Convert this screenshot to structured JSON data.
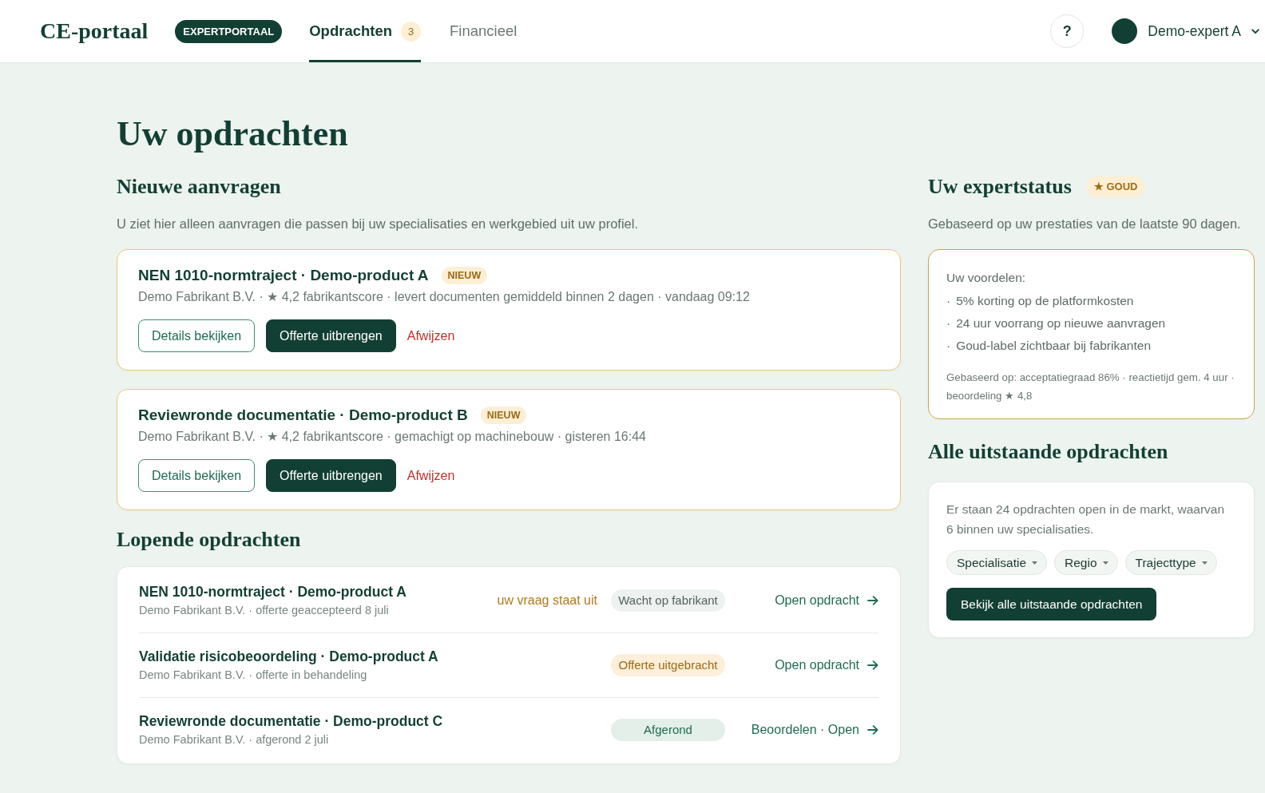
{
  "header": {
    "logo": "CE-portaal",
    "portal_badge": "EXPERTPORTAAL",
    "tabs": [
      {
        "label": "Opdrachten",
        "count": "3",
        "selected": true
      },
      {
        "label": "Financieel",
        "selected": false
      }
    ],
    "help_button": "?",
    "user": {
      "name": "Demo-expert A"
    }
  },
  "page_title": "Uw opdrachten",
  "new_requests": {
    "title": "Nieuwe aanvragen",
    "description": "U ziet hier alleen aanvragen die passen bij uw specialisaties en werkgebied uit uw profiel.",
    "cards": [
      {
        "title": "NEN 1010-normtraject · Demo-product A",
        "badge": "NIEUW",
        "meta": "Demo Fabrikant B.V. · ★ 4,2 fabrikantscore · levert documenten gemiddeld binnen 2 dagen · vandaag 09:12",
        "actions": [
          {
            "label": "Details bekijken",
            "kind": "secondary"
          },
          {
            "label": "Offerte uitbrengen",
            "kind": "primary"
          },
          {
            "label": "Afwijzen",
            "kind": "danger"
          }
        ]
      },
      {
        "title": "Reviewronde documentatie · Demo-product B",
        "badge": "NIEUW",
        "meta": "Demo Fabrikant B.V. · ★ 4,2 fabrikantscore · gemachigt op machinebouw · gisteren 16:44",
        "actions": [
          {
            "label": "Details bekijken",
            "kind": "secondary"
          },
          {
            "label": "Offerte uitbrengen",
            "kind": "primary"
          },
          {
            "label": "Afwijzen",
            "kind": "danger"
          }
        ]
      }
    ]
  },
  "running": {
    "title": "Lopende opdrachten",
    "rows": [
      {
        "title": "NEN 1010-normtraject · Demo-product A",
        "subtitle": "Demo Fabrikant B.V. · offerte geaccepteerd 8 juli",
        "note": "uw vraag staat uit",
        "status": {
          "label": "Wacht op fabrikant",
          "kind": "neutral"
        },
        "link": "Open opdracht"
      },
      {
        "title": "Validatie risicobeoordeling · Demo-product A",
        "subtitle": "Demo Fabrikant B.V. · offerte in behandeling",
        "status": {
          "label": "Offerte uitgebracht",
          "kind": "warning"
        },
        "link": "Open opdracht"
      },
      {
        "title": "Reviewronde documentatie · Demo-product C",
        "subtitle": "Demo Fabrikant B.V. · afgerond 2 juli",
        "status": {
          "label": "Afgerond",
          "kind": "success"
        },
        "link": "Beoordelen · Open"
      }
    ]
  },
  "expert_status": {
    "title": "Uw expertstatus",
    "badge": "★ GOUD",
    "subtitle": "Gebaseerd op uw prestaties van de laatste 90 dagen.",
    "benefits_title": "Uw voordelen:",
    "benefits": [
      {
        "marker": "·",
        "text": "5% korting op de platformkosten"
      },
      {
        "marker": "·",
        "text": "24 uur voorrang op nieuwe aanvragen"
      },
      {
        "marker": "·",
        "text": "Goud-label zichtbaar bij fabrikanten"
      }
    ],
    "footnote": "Gebaseerd op: acceptatiegraad 86% · reactietijd gem. 4 uur · beoordeling ★ 4,8"
  },
  "outstanding": {
    "title": "Alle uitstaande opdrachten",
    "text": "Er staan 24 opdrachten open in de markt, waarvan 6 binnen uw specialisaties.",
    "filters": [
      "Specialisatie",
      "Regio",
      "Trajecttype"
    ],
    "button": "Bekijk alle uitstaande opdrachten"
  }
}
